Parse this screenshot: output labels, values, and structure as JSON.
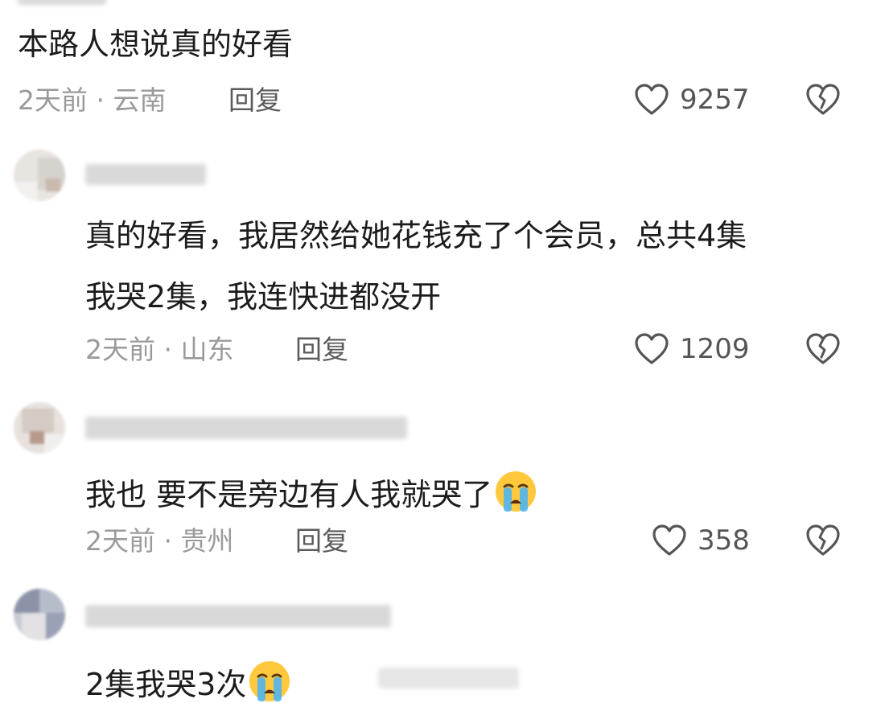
{
  "comments": [
    {
      "text": "本路人想说真的好看",
      "time": "2天前",
      "location": "云南",
      "reply_label": "回复",
      "likes": "9257"
    },
    {
      "text_line1": "真的好看，我居然给她花钱充了个会员，总共4集",
      "text_line2": "我哭2集，我连快进都没开",
      "time": "2天前",
      "location": "山东",
      "reply_label": "回复",
      "likes": "1209"
    },
    {
      "text": "我也 要不是旁边有人我就哭了",
      "emoji": "crying-face",
      "time": "2天前",
      "location": "贵州",
      "reply_label": "回复",
      "likes": "358"
    },
    {
      "text": "2集我哭3次",
      "emoji": "crying-face"
    }
  ],
  "separator": " · ",
  "icons": {
    "like": "heart-outline-icon",
    "dislike": "broken-heart-icon"
  }
}
